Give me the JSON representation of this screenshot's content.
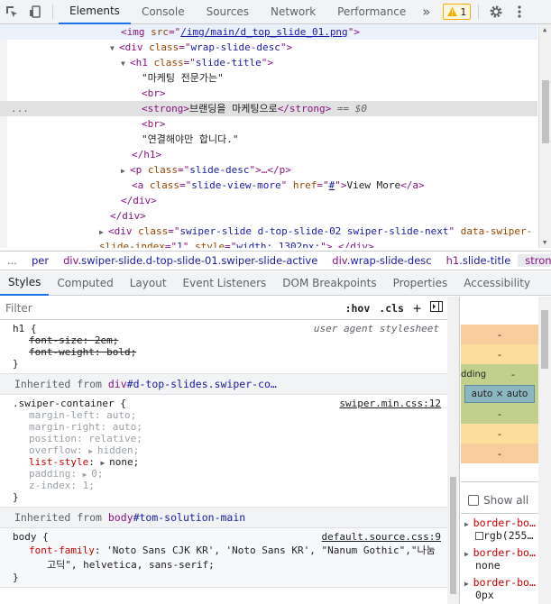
{
  "toolbar": {
    "tabs": [
      "Elements",
      "Console",
      "Sources",
      "Network",
      "Performance"
    ],
    "more": "»",
    "warn_count": "1"
  },
  "dom": {
    "l0": {
      "open": "<img ",
      "attr": "src",
      "eq": "=\"",
      "val": "/img/main/d_top_slide_01.png",
      "close": "\">"
    },
    "l1": {
      "open": "<div ",
      "attr": "class",
      "eq": "=\"",
      "val": "wrap-slide-desc",
      "close": "\">"
    },
    "l2": {
      "open": "<h1 ",
      "attr": "class",
      "eq": "=\"",
      "val": "slide-title",
      "close": "\">"
    },
    "l3": "\"마케팅 전문가는\"",
    "l4": "<br>",
    "l5": {
      "open": "<strong>",
      "text": "브랜딩을 마케팅으로",
      "close": "</strong>",
      "eq0": " == $0",
      "dots": "..."
    },
    "l6": "<br>",
    "l7": "\"연결해야만 합니다.\"",
    "l8": "</h1>",
    "l9": {
      "open": "<p ",
      "attr": "class",
      "eq": "=\"",
      "val": "slide-desc",
      "close": "\">…</p>"
    },
    "l10": {
      "open": "<a ",
      "attr": "class",
      "eq": "=\"",
      "val": "slide-view-more",
      "close": "\" ",
      "attr2": "href",
      "eq2": "=\"",
      "val2": "#",
      "close2": "\">",
      "text": "View More",
      "end": "</a>"
    },
    "l11": "</div>",
    "l12": "</div>",
    "l13": {
      "open": "<div ",
      "attr": "class",
      "eq": "=\"",
      "val": "swiper-slide d-top-slide-02 swiper-slide-next",
      "close": "\" ",
      "attr2": "data-swiper-"
    },
    "l14": {
      "attr": "slide-index",
      "eq": "=\"",
      "val": "1",
      "close": "\" ",
      "attr2": "style",
      "eq2": "=\"",
      "val2": "width: 1302px;",
      "close2": "\">…</div>"
    }
  },
  "breadcrumb": {
    "dots": "...",
    "c0": "per",
    "c1t": "div",
    "c1c": ".swiper-slide.d-top-slide-01.swiper-slide-active",
    "c2t": "div",
    "c2c": ".wrap-slide-desc",
    "c3t": "h1",
    "c3c": ".slide-title",
    "c4t": "strong"
  },
  "subtabs": [
    "Styles",
    "Computed",
    "Layout",
    "Event Listeners",
    "DOM Breakpoints",
    "Properties",
    "Accessibility"
  ],
  "filter": {
    "placeholder": "Filter",
    "hov": ":hov",
    "cls": ".cls",
    "plus": "+"
  },
  "rules": {
    "h1": {
      "selector": "h1 {",
      "source": "user agent stylesheet",
      "p1n": "font-size",
      "p1v": "2em;",
      "p2n": "font-weight",
      "p2v": "bold;",
      "close": "}"
    },
    "inh1": {
      "label": "Inherited from ",
      "tag": "div",
      "cls": "#d-top-slides.swiper-co…"
    },
    "swiper": {
      "selector": ".swiper-container {",
      "source": "swiper.min.css:12",
      "props": [
        {
          "n": "margin-left",
          "v": "auto;"
        },
        {
          "n": "margin-right",
          "v": "auto;"
        },
        {
          "n": "position",
          "v": "relative;"
        },
        {
          "n": "overflow",
          "v": "hidden;"
        },
        {
          "n": "list-style",
          "v": "none;"
        },
        {
          "n": "padding",
          "v": "0;"
        },
        {
          "n": "z-index",
          "v": "1;"
        }
      ],
      "close": "}"
    },
    "inh2": {
      "label": "Inherited from ",
      "tag": "body",
      "cls": "#tom-solution-main"
    },
    "body": {
      "selector": "body {",
      "source": "default.source.css:9",
      "pn": "font-family",
      "pv1": "'Noto Sans CJK KR', 'Noto Sans KR', \"Nanum Gothic\",\"나눔",
      "pv2": "고딕\", helvetica, sans-serif;",
      "close": "}"
    }
  },
  "side": {
    "bm_dash": "-",
    "padding": "dding",
    "content": "auto × auto",
    "show_all": "Show all",
    "c1n": "border-bo…",
    "c1v": "rgb(255…",
    "c2n": "border-bo…",
    "c2v": "none",
    "c3n": "border-bo…",
    "c3v": "0px"
  }
}
